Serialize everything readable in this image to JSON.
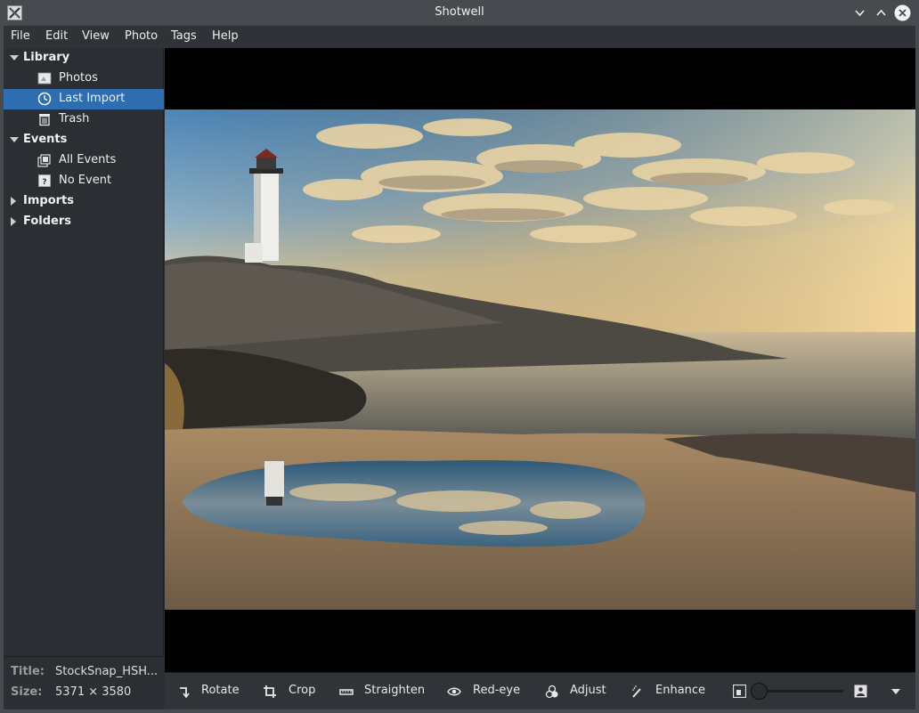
{
  "window": {
    "title": "Shotwell",
    "icon": "x-app-icon",
    "controls": [
      "minimize-icon",
      "maximize-icon",
      "close-icon"
    ]
  },
  "menubar": {
    "items": [
      "File",
      "Edit",
      "View",
      "Photo",
      "Tags",
      "Help"
    ]
  },
  "sidebar": {
    "library": {
      "label": "Library",
      "expanded": true,
      "items": [
        {
          "label": "Photos",
          "icon": "photos-icon"
        },
        {
          "label": "Last Import",
          "icon": "clock-icon",
          "selected": true
        },
        {
          "label": "Trash",
          "icon": "trash-icon"
        }
      ]
    },
    "events": {
      "label": "Events",
      "expanded": true,
      "items": [
        {
          "label": "All Events",
          "icon": "all-events-icon"
        },
        {
          "label": "No Event",
          "icon": "no-event-icon"
        }
      ]
    },
    "imports": {
      "label": "Imports",
      "expanded": false
    },
    "folders": {
      "label": "Folders",
      "expanded": false
    }
  },
  "info": {
    "title_label": "Title:",
    "title_value": "StockSnap_HSH...",
    "size_label": "Size:",
    "size_value": "5371 × 3580"
  },
  "photo": {
    "subject": "lighthouse-on-rocks-at-sunset"
  },
  "toolbar": {
    "rotate": "Rotate",
    "crop": "Crop",
    "straighten": "Straighten",
    "redeye": "Red-eye",
    "adjust": "Adjust",
    "enhance": "Enhance",
    "zoom_level": 0.0
  },
  "colors": {
    "selection": "#2e6daf",
    "titlebar": "#474b4f",
    "sidebar": "#2b2e32"
  }
}
